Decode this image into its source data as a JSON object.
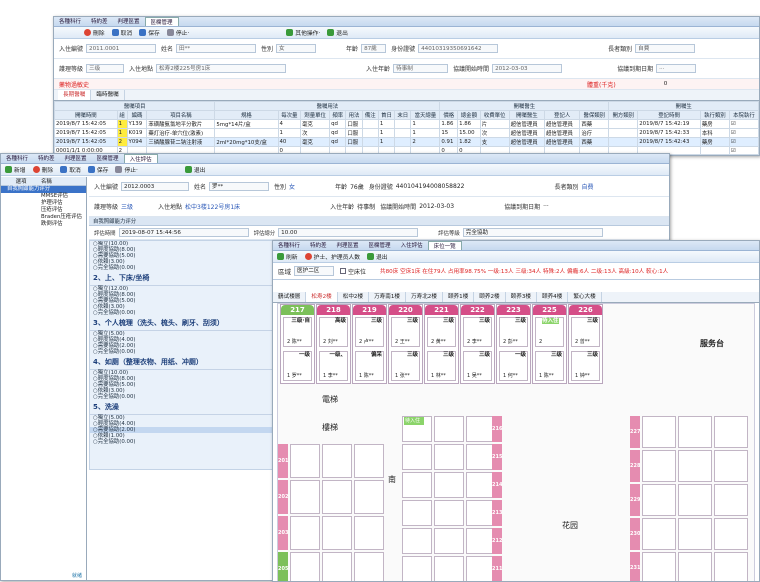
{
  "win1": {
    "menu": [
      "各種科行",
      "特約差",
      "判理區置",
      "區欄管理"
    ],
    "toolbar": [
      "刪除",
      "取消",
      "保存",
      "停止·",
      "其他操作·",
      "退出"
    ],
    "fields": {
      "inpatient_no_label": "入住編號",
      "inpatient_no": "2011.0001",
      "name_label": "姓名",
      "name": "田**",
      "sex_label": "性別",
      "sex": "女",
      "age_label": "年齡",
      "age": "87歲",
      "id_label": "身份證號",
      "id": "44010319350691642",
      "elder_type_label": "長者類別",
      "elder_type": "自費",
      "nurse_level_label": "護理等級",
      "nurse_level": "三级",
      "place_label": "入住地點",
      "place": "松寿2楼225号房1床",
      "date_label": "入住年齡",
      "date": "待事制",
      "start_label": "協議開始時間",
      "start": "2012-03-03",
      "end_label": "協議到期日期",
      "end": "···"
    },
    "allergy_label": "藥物過敏史",
    "weight_label": "體重(千克)",
    "weight_value": "0",
    "tabs": [
      "長期醫囑",
      "臨時醫囑"
    ],
    "group_headers": {
      "items": "醫囑項目",
      "usage": "醫囑用法",
      "orders": "開囑醫生",
      "exec": "開囑生"
    },
    "columns": [
      "開囑時間",
      "組",
      "編碼",
      "項目名稱",
      "規格",
      "每次量",
      "劑量單位",
      "頻率",
      "用法",
      "備注",
      "首日",
      "末日",
      "當天總量",
      "價格",
      "總金額",
      "收費單位",
      "開囑醫生",
      "登記人",
      "醫保類別",
      "開方類別",
      "登記時間",
      "執行類別",
      "本院執行"
    ],
    "rows": [
      [
        "2019/8/7 15:42:05",
        "1",
        "Y139",
        "苯磺酸氨氯地平分散片",
        "5mg*14片/盒",
        "4",
        "毫克",
        "qd",
        "口服",
        "",
        "1",
        "",
        "1",
        "1.86",
        "1.86",
        "片",
        "超信管理員",
        "超信管理員",
        "西藥",
        "",
        "2019/8/7 15:42:19",
        "藥房",
        "☑"
      ],
      [
        "2019/8/7 15:42:05",
        "1",
        "K019",
        "藥灯治疗-单穴位(激素)",
        "",
        "1",
        "次",
        "qd",
        "口服",
        "",
        "1",
        "",
        "1",
        "15",
        "15.00",
        "次",
        "超信管理員",
        "超信管理員",
        "治疗",
        "",
        "2019/8/7 15:42:33",
        "本科",
        "☑"
      ],
      [
        "2019/8/7 15:42:05",
        "2",
        "Y094",
        "三磷酸腺苷二钠注射液",
        "2ml*20mg*10支/盒",
        "40",
        "毫克",
        "qd",
        "口服",
        "",
        "1",
        "",
        "2",
        "0.91",
        "1.82",
        "支",
        "超信管理員",
        "超信管理員",
        "西藥",
        "",
        "2019/8/7 15:42:43",
        "藥房",
        "☑"
      ],
      [
        "0001/1/1 0:00:00",
        "2",
        "",
        "",
        "",
        "0",
        "",
        "",
        "",
        "",
        "",
        "",
        "",
        "0",
        "0",
        "",
        "",
        "",
        "",
        "",
        "",
        "",
        "☑"
      ]
    ]
  },
  "win2": {
    "menu": [
      "各種科行",
      "特約差",
      "判理區置",
      "區欄管理",
      "入住評估"
    ],
    "toolbar": [
      "新增",
      "刪除",
      "取消",
      "保存",
      "停止·",
      "退出"
    ],
    "tree_headers": [
      "選項",
      "名稱"
    ],
    "tree": [
      "自我照顧能力评分",
      "MMSE评估",
      "护理评估",
      "压疮评估",
      "Braden压疮评估",
      "跌倒评估"
    ],
    "fields": {
      "inpatient_no_label": "入住編號",
      "inpatient_no": "2012.0003",
      "name_label": "姓名",
      "name": "罗**",
      "sex_label": "性別",
      "sex": "女",
      "age_label": "年齡",
      "age": "76歲",
      "id_label": "身份證號",
      "id": "440104194008058822",
      "elder_type_label": "長者類別",
      "elder_type": "自費",
      "nurse_level_label": "護理等級",
      "nurse_level": "三级",
      "place_label": "入住地點",
      "place": "松中3楼122号房1床",
      "date_label": "入住年齡",
      "date": "待事制",
      "start_label": "協議開始時間",
      "start": "2012-03-03",
      "end_label": "協議到期日期",
      "end": "···"
    },
    "assess_title": "自我照顧能力评分",
    "assess_time_label": "評估時間",
    "assess_time": "2019-08-07 15:44:56",
    "total_label": "評估總分",
    "total": "10.00",
    "result_label": "評估等級",
    "result": "完全協助",
    "sections": [
      {
        "title": "",
        "opts": [
          "獨立(10.00)",
          "輕度協助(8.00)",
          "需要協助(5.00)",
          "依賴(3.00)",
          "完全協助(0.00)"
        ]
      },
      {
        "title": "2、上、下床/坐椅",
        "opts": [
          "獨立(12.00)",
          "輕度協助(8.00)",
          "需要協助(5.00)",
          "依賴(3.00)",
          "完全協助(0.00)"
        ]
      },
      {
        "title": "3、个人梳理（洗头、梳头、刷牙、刮须）",
        "opts": [
          "獨立(5.00)",
          "輕度協助(4.00)",
          "需要協助(2.00)",
          "完全協助(0.00)"
        ]
      },
      {
        "title": "4、如厕（整理衣物、用纸、冲厕）",
        "opts": [
          "獨立(10.00)",
          "輕度協助(8.00)",
          "需要協助(5.00)",
          "依賴(3.00)",
          "完全協助(0.00)"
        ]
      },
      {
        "title": "5、洗澡",
        "opts": [
          "獨立(5.00)",
          "輕度協助(4.00)",
          "需要協助(2.00)",
          "依賴(1.00)",
          "完全協助(0.00)"
        ]
      }
    ],
    "status": "就绪"
  },
  "win3": {
    "menu": [
      "各種科行",
      "特約差",
      "判理區置",
      "區欄管理",
      "入住評估",
      "床位一覽"
    ],
    "toolbar": [
      "刷新",
      "护士、护理员人数",
      "退出"
    ],
    "area_label": "區域",
    "area": "医护二区",
    "vacant_check": "空床位",
    "stats": "共80床  空床1床  在住79人  占用率98.75%    一级:13人  三级:34人  特殊:2人  偏癱:6人  二级:13人  高級:10人  較心:1人",
    "floor_tabs": [
      "鶴试楼層",
      "松寿2楼",
      "松中2楼",
      "万寿南1楼",
      "万寿北2楼",
      "颐养1楼",
      "颐养2楼",
      "颐养3楼",
      "颐养4楼",
      "繁心大楼"
    ],
    "rooms_top": [
      {
        "no": "217",
        "green": true,
        "beds": [
          {
            "lv": "三级·自",
            "nm": "2 陈**"
          },
          {
            "lv": "一级",
            "nm": "1 罗**"
          }
        ]
      },
      {
        "no": "218",
        "beds": [
          {
            "lv": "高级",
            "nm": "2 刘**"
          },
          {
            "lv": "一级、",
            "nm": "1 李**"
          }
        ]
      },
      {
        "no": "219",
        "beds": [
          {
            "lv": "三级",
            "nm": "2 卢**"
          },
          {
            "lv": "偏呆",
            "nm": "1 陈**"
          }
        ]
      },
      {
        "no": "220",
        "beds": [
          {
            "lv": "三级",
            "nm": "2 王**"
          },
          {
            "lv": "三级",
            "nm": "1 张**"
          }
        ]
      },
      {
        "no": "221",
        "beds": [
          {
            "lv": "三级",
            "nm": "2 黄**"
          },
          {
            "lv": "三级",
            "nm": "1 林**"
          }
        ]
      },
      {
        "no": "222",
        "beds": [
          {
            "lv": "三级",
            "nm": "2 李**"
          },
          {
            "lv": "三级",
            "nm": "1 吴**"
          }
        ]
      },
      {
        "no": "223",
        "beds": [
          {
            "lv": "三级",
            "nm": "2 彭**"
          },
          {
            "lv": "一级",
            "nm": "1 何**"
          }
        ]
      },
      {
        "no": "225",
        "beds": [
          {
            "lv": "待入住",
            "nm": "2"
          },
          {
            "lv": "三级",
            "nm": "1 陈**"
          }
        ]
      },
      {
        "no": "226",
        "beds": [
          {
            "lv": "三级",
            "nm": "2 曾**"
          },
          {
            "lv": "三级",
            "nm": "1 钟**"
          }
        ]
      }
    ],
    "labels": {
      "elevator": "電梯",
      "stairs": "樓梯",
      "south": "南",
      "garden": "花园",
      "service": "服务台"
    },
    "left_rooms": [
      "201",
      "202",
      "203",
      "205"
    ],
    "mid_rooms": [
      "216",
      "215",
      "214",
      "213",
      "212",
      "211"
    ],
    "right_rooms": [
      "227",
      "228",
      "229",
      "230",
      "231"
    ],
    "pending": "待入住"
  }
}
